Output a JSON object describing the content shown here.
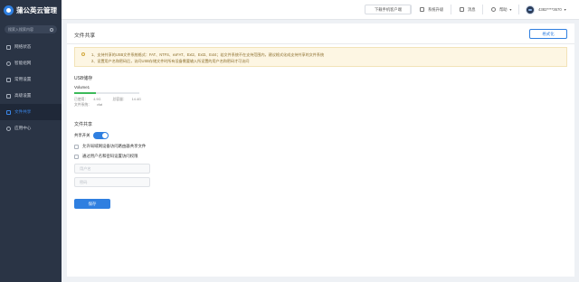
{
  "app": {
    "title": "蒲公英云管理"
  },
  "sidebar": {
    "search_placeholder": "搜索入搜索内容",
    "items": [
      {
        "label": "网络状态",
        "icon": "monitor-icon",
        "active": false
      },
      {
        "label": "智能组网",
        "icon": "network-icon",
        "active": false
      },
      {
        "label": "常用设置",
        "icon": "settings-icon",
        "active": false
      },
      {
        "label": "高级设置",
        "icon": "advanced-settings-icon",
        "active": false
      },
      {
        "label": "文件共享",
        "icon": "folder-icon",
        "active": true
      },
      {
        "label": "应用中心",
        "icon": "apps-icon",
        "active": false
      }
    ]
  },
  "topbar": {
    "download_label": "下载手机客户端",
    "upgrade_label": "系统升级",
    "messages_label": "消息",
    "help_label": "帮助",
    "user_label": "4382****3670"
  },
  "page": {
    "title": "文件共享",
    "format_button": "格式化",
    "notice": {
      "line1": "1、支持共享的USB文件系统格式：FAT、NTFS、exFAT、Ext2、Ext3、Ext4；若文件系统不在支持范围内，建议格式化成支持共享的文件系统",
      "line2": "2、设置用户名和密码后，访问USB存储文件时所有设备需要输入所设置的用户名和密码才可访问"
    },
    "usb": {
      "section_title": "USB储存",
      "volume_name": "Volume1",
      "used_fraction": 0.33,
      "used_label": "已使用：",
      "used_value": "4.9G",
      "total_label": "总容量：",
      "total_value": "14.4G",
      "fs_label": "文件系统：",
      "fs_value": "vfat"
    },
    "share": {
      "section_title": "文件共享",
      "switch_label": "共享开关",
      "switch_on": true,
      "option1": "允许局域网设备访问路由器共享文件",
      "option2": "通过用户名和密码设置访问权限",
      "username_placeholder": "用户名",
      "password_placeholder": "密码",
      "save_label": "保存"
    }
  },
  "colors": {
    "accent": "#2f7fe0",
    "sidebar_bg": "#2a3445",
    "usage_fill": "#3cba5a",
    "notice_bg": "#fdf6e3"
  }
}
